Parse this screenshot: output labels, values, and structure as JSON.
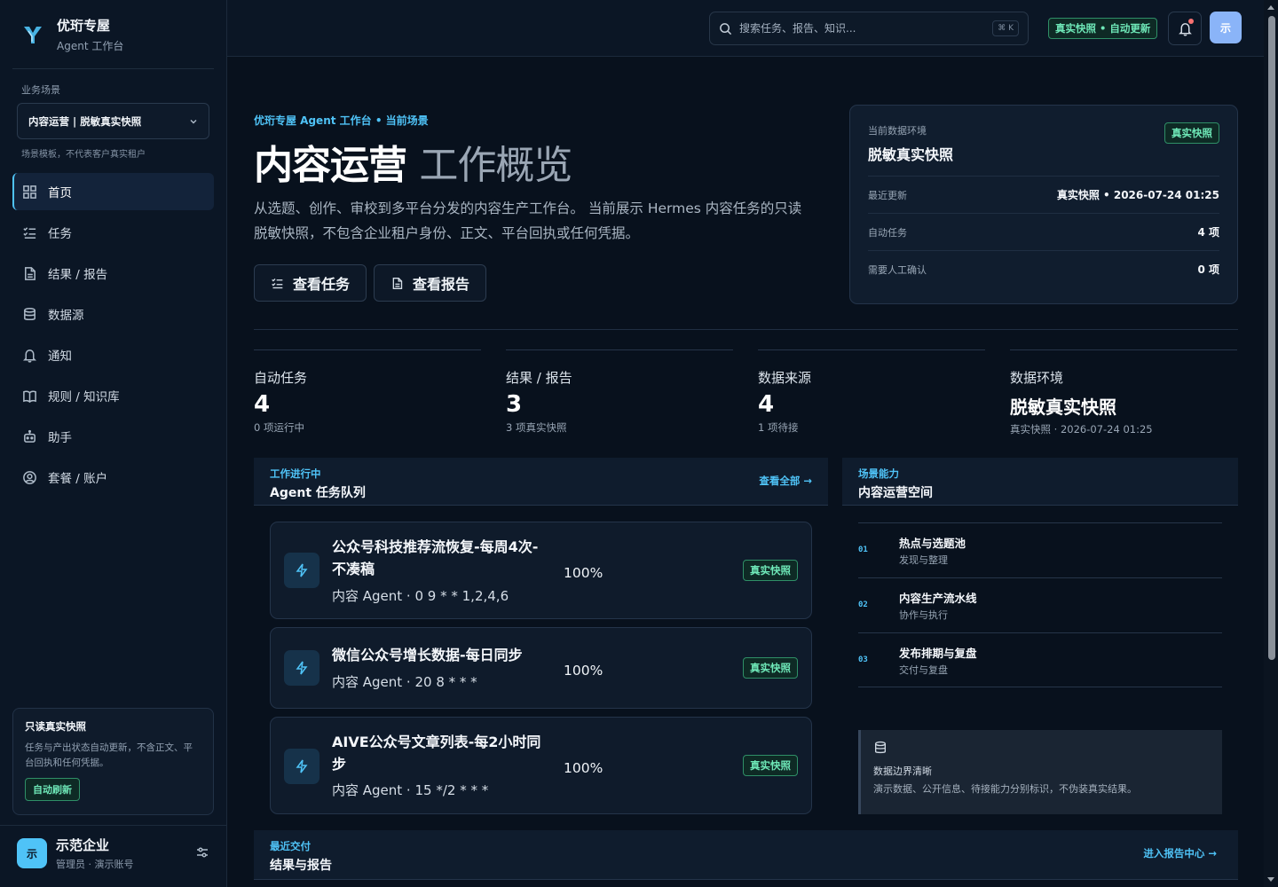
{
  "brand": {
    "name": "优珩专屋",
    "subtitle": "Agent 工作台"
  },
  "scene": {
    "label": "业务场景",
    "selected": "内容运营 | 脱敏真实快照",
    "note": "场景模板，不代表客户真实租户"
  },
  "nav": [
    {
      "label": "首页",
      "icon": "dashboard-icon",
      "active": true
    },
    {
      "label": "任务",
      "icon": "checklist-icon"
    },
    {
      "label": "结果 / 报告",
      "icon": "document-icon"
    },
    {
      "label": "数据源",
      "icon": "database-icon"
    },
    {
      "label": "通知",
      "icon": "bell-icon"
    },
    {
      "label": "规则 / 知识库",
      "icon": "book-icon"
    },
    {
      "label": "助手",
      "icon": "bot-icon"
    },
    {
      "label": "套餐 / 账户",
      "icon": "account-icon"
    }
  ],
  "notice": {
    "title": "只读真实快照",
    "text": "任务与产出状态自动更新，不含正文、平台回执和任何凭据。",
    "button": "自动刷新"
  },
  "user": {
    "avatar": "示",
    "name": "示范企业",
    "role": "管理员 · 演示账号"
  },
  "topbar": {
    "search_placeholder": "搜索任务、报告、知识...",
    "shortcut": "⌘ K",
    "badge": "真实快照 • 自动更新",
    "avatar": "示"
  },
  "hero": {
    "eyebrow": "优珩专屋 Agent 工作台 • 当前场景",
    "title_main": "内容运营",
    "title_light": "工作概览",
    "description": "从选题、创作、审校到多平台分发的内容生产工作台。 当前展示 Hermes 内容任务的只读脱敏快照，不包含企业租户身份、正文、平台回执或任何凭据。",
    "btn_tasks": "查看任务",
    "btn_reports": "查看报告"
  },
  "env_card": {
    "label": "当前数据环境",
    "value": "脱敏真实快照",
    "badge": "真实快照",
    "rows": [
      {
        "k": "最近更新",
        "v": "真实快照 • 2026-07-24 01:25"
      },
      {
        "k": "自动任务",
        "v": "4 项"
      },
      {
        "k": "需要人工确认",
        "v": "0 项"
      }
    ]
  },
  "stats": [
    {
      "label": "自动任务",
      "value": "4",
      "sub": "0 项运行中"
    },
    {
      "label": "结果 / 报告",
      "value": "3",
      "sub": "3 项真实快照"
    },
    {
      "label": "数据来源",
      "value": "4",
      "sub": "1 项待接"
    },
    {
      "label": "数据环境",
      "value": "脱敏真实快照",
      "sub": "真实快照 · 2026-07-24 01:25"
    }
  ],
  "queue": {
    "eyebrow": "工作进行中",
    "title": "Agent 任务队列",
    "link": "查看全部 →",
    "tasks": [
      {
        "name": "公众号科技推荐流恢复-每周4次-不凑稿",
        "meta": "内容 Agent · 0 9 * * 1,2,4,6",
        "pct": "100%",
        "badge": "真实快照"
      },
      {
        "name": "微信公众号增长数据-每日同步",
        "meta": "内容 Agent · 20 8 * * *",
        "pct": "100%",
        "badge": "真实快照"
      },
      {
        "name": "AIVE公众号文章列表-每2小时同步",
        "meta": "内容 Agent · 15 */2 * * *",
        "pct": "100%",
        "badge": "真实快照"
      }
    ]
  },
  "capabilities": {
    "eyebrow": "场景能力",
    "title": "内容运营空间",
    "items": [
      {
        "num": "01",
        "title": "热点与选题池",
        "sub": "发现与整理"
      },
      {
        "num": "02",
        "title": "内容生产流水线",
        "sub": "协作与执行"
      },
      {
        "num": "03",
        "title": "发布排期与复盘",
        "sub": "交付与复盘"
      }
    ]
  },
  "boundary": {
    "title": "数据边界清晰",
    "text": "演示数据、公开信息、待接能力分别标识，不伪装真实结果。"
  },
  "deliveries": {
    "eyebrow": "最近交付",
    "title": "结果与报告",
    "link": "进入报告中心 →"
  }
}
